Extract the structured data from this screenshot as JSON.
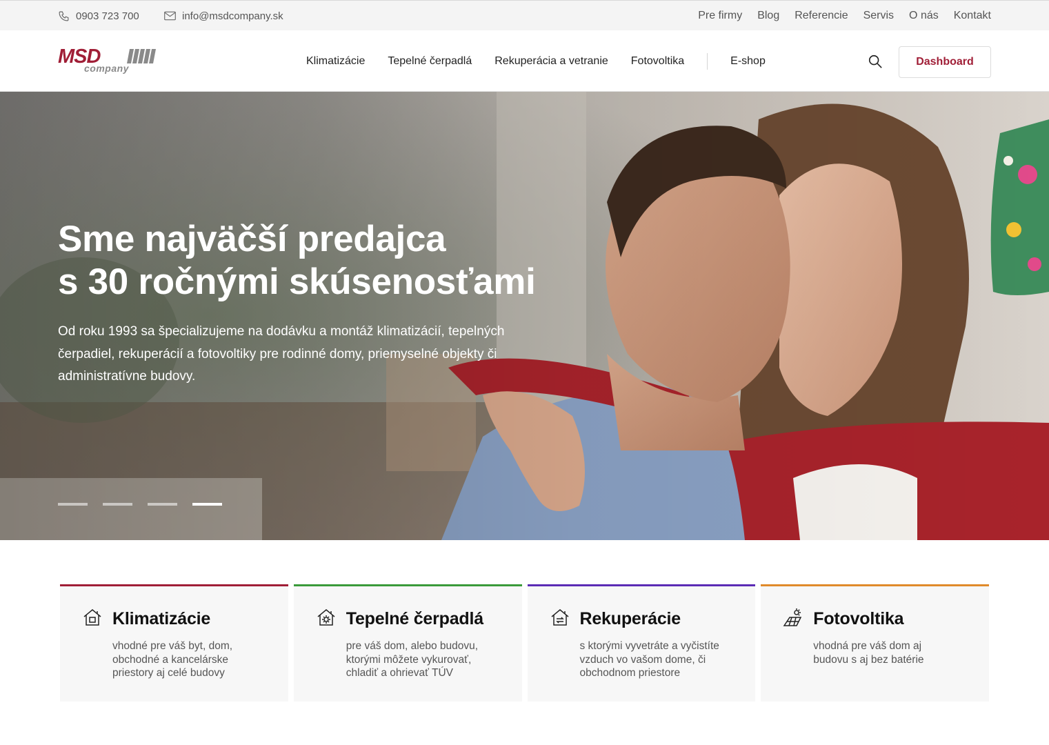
{
  "topbar": {
    "phone": "0903 723 700",
    "email": "info@msdcompany.sk",
    "links": [
      "Pre firmy",
      "Blog",
      "Referencie",
      "Servis",
      "O nás",
      "Kontakt"
    ]
  },
  "header": {
    "logo_text": "MSD",
    "logo_sub": "company",
    "nav": [
      "Klimatizácie",
      "Tepelné čerpadlá",
      "Rekuperácia a vetranie",
      "Fotovoltika"
    ],
    "eshop": "E-shop",
    "dashboard_label": "Dashboard"
  },
  "hero": {
    "title_line1": "Sme najväčší predajca",
    "title_line2": "s 30 ročnými skúsenosťami",
    "text": "Od roku 1993 sa špecializujeme na dodávku a montáž klimatizácií, tepelných čerpadiel, rekuperácií a fotovoltiky pre rodinné domy, priemyselné objekty či administratívne budovy.",
    "slides_total": 4,
    "active_slide": 4
  },
  "cards": [
    {
      "title": "Klimatizácie",
      "text": "vhodné pre váš byt, dom, obchodné a kancelárske priestory aj celé budovy",
      "color": "#a01e36",
      "icon": "house-ac-icon"
    },
    {
      "title": "Tepelné čerpadlá",
      "text": "pre váš dom, alebo budovu, ktorými môžete vykurovať, chladiť a ohrievať TÚV",
      "color": "#3a9a3a",
      "icon": "house-sun-icon"
    },
    {
      "title": "Rekuperácie",
      "text": "s ktorými vyvetráte a vyčistíte vzduch vo vašom dome, či obchodnom priestore",
      "color": "#5b2bb5",
      "icon": "house-recirculation-icon"
    },
    {
      "title": "Fotovoltika",
      "text": "vhodná pre váš dom aj budovu s aj bez batérie",
      "color": "#e08a2a",
      "icon": "solar-panel-icon"
    }
  ],
  "colors": {
    "brand": "#a01e36",
    "topbar_bg": "#f4f4f4",
    "card_bg": "#f7f7f7"
  }
}
